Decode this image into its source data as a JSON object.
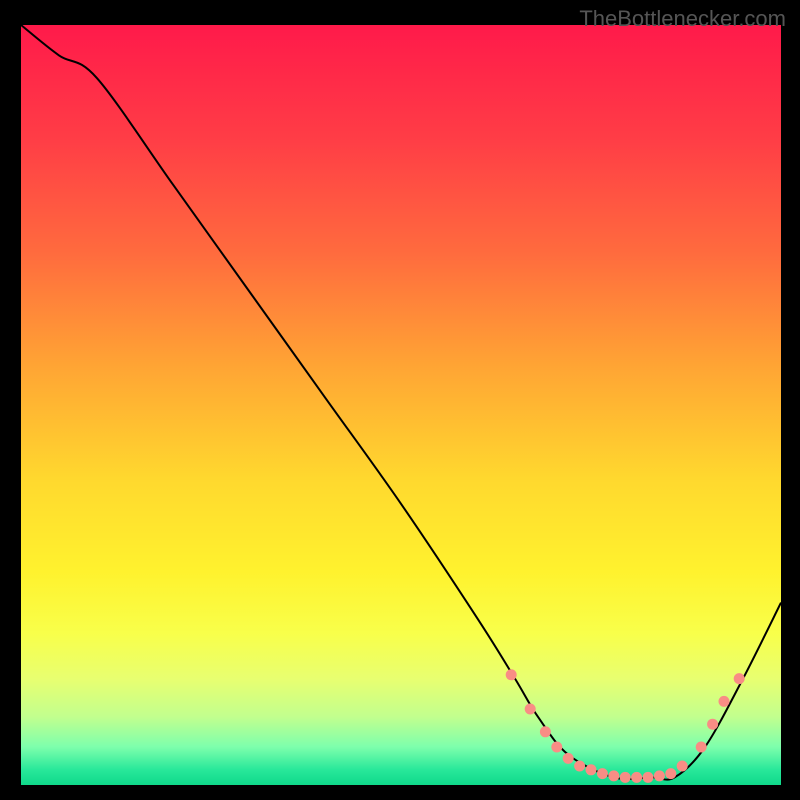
{
  "watermark": "TheBottlenecker.com",
  "chart_data": {
    "type": "line",
    "title": "",
    "xlabel": "",
    "ylabel": "",
    "xlim": [
      0,
      100
    ],
    "ylim": [
      0,
      100
    ],
    "grid": false,
    "series": [
      {
        "name": "curve",
        "x": [
          0,
          5,
          10,
          20,
          30,
          40,
          50,
          60,
          65,
          68,
          72,
          78,
          83,
          86,
          90,
          95,
          100
        ],
        "values": [
          100,
          96,
          93,
          79,
          65,
          51,
          37,
          22,
          14,
          9,
          4,
          1,
          1,
          1,
          5,
          14,
          24
        ],
        "color": "#000000"
      }
    ],
    "markers": {
      "name": "dots",
      "color": "#f98d85",
      "points": [
        {
          "x": 64.5,
          "y": 14.5
        },
        {
          "x": 67,
          "y": 10
        },
        {
          "x": 69,
          "y": 7
        },
        {
          "x": 70.5,
          "y": 5
        },
        {
          "x": 72,
          "y": 3.5
        },
        {
          "x": 73.5,
          "y": 2.5
        },
        {
          "x": 75,
          "y": 2
        },
        {
          "x": 76.5,
          "y": 1.5
        },
        {
          "x": 78,
          "y": 1.2
        },
        {
          "x": 79.5,
          "y": 1
        },
        {
          "x": 81,
          "y": 1
        },
        {
          "x": 82.5,
          "y": 1
        },
        {
          "x": 84,
          "y": 1.2
        },
        {
          "x": 85.5,
          "y": 1.5
        },
        {
          "x": 87,
          "y": 2.5
        },
        {
          "x": 89.5,
          "y": 5
        },
        {
          "x": 91,
          "y": 8
        },
        {
          "x": 92.5,
          "y": 11
        },
        {
          "x": 94.5,
          "y": 14
        }
      ]
    },
    "background_gradient": {
      "stops": [
        {
          "offset": 0.0,
          "color": "#ff1a4a"
        },
        {
          "offset": 0.15,
          "color": "#ff3d46"
        },
        {
          "offset": 0.3,
          "color": "#ff6b3e"
        },
        {
          "offset": 0.45,
          "color": "#ffa534"
        },
        {
          "offset": 0.6,
          "color": "#ffd92e"
        },
        {
          "offset": 0.72,
          "color": "#fff22e"
        },
        {
          "offset": 0.8,
          "color": "#f8ff4a"
        },
        {
          "offset": 0.86,
          "color": "#e8ff70"
        },
        {
          "offset": 0.91,
          "color": "#c2ff8e"
        },
        {
          "offset": 0.95,
          "color": "#7dffac"
        },
        {
          "offset": 0.98,
          "color": "#28e89a"
        },
        {
          "offset": 1.0,
          "color": "#0fd98a"
        }
      ]
    }
  }
}
